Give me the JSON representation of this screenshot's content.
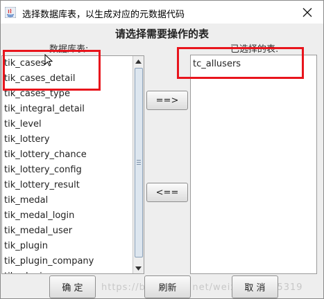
{
  "window": {
    "title": "选择数据库表，以生成对应的元数据代码"
  },
  "dialog": {
    "heading": "请选择需要操作的表",
    "left_label": "数据库表:",
    "right_label": "已选择的表:"
  },
  "database_tables": [
    "tik_cases",
    "tik_cases_detail",
    "tik_cases_type",
    "tik_integral_detail",
    "tik_level",
    "tik_lottery",
    "tik_lottery_chance",
    "tik_lottery_config",
    "tik_lottery_result",
    "tik_medal",
    "tik_medal_login",
    "tik_medal_user",
    "tik_plugin",
    "tik_plugin_company",
    "tik_plugin_user"
  ],
  "selected_tables": [
    "tc_allusers"
  ],
  "buttons": {
    "move_right": "==>",
    "move_left": "<==",
    "ok": "确 定",
    "refresh": "刷新",
    "cancel": "取 消"
  },
  "watermark": "https://blog.csdn.net/weixin_38845319",
  "colors": {
    "highlight": "#e8141c",
    "background": "#eeeeee"
  }
}
